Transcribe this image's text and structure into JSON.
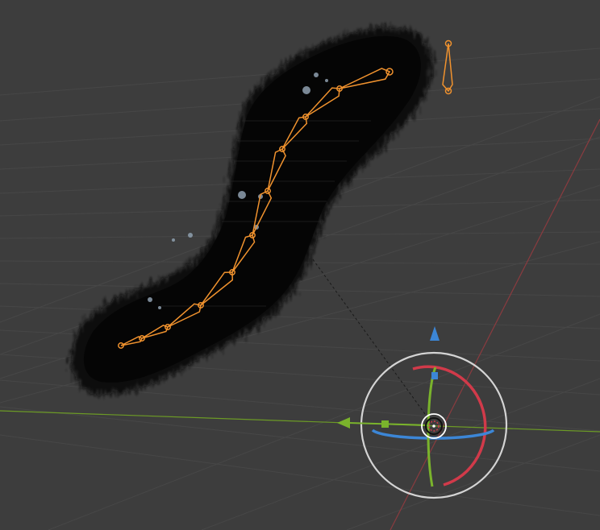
{
  "viewport": {
    "background": "#3d3d3d",
    "grid_color": "#474747",
    "x_axis_color": "#8a3b3f",
    "y_axis_color": "#6c9a26"
  },
  "object": {
    "fur_color": "#0a0a0a",
    "bone_color": "#f0922e"
  },
  "gizmo": {
    "outer_ring_color": "#d4d4d4",
    "x_color": "#d13a4a",
    "y_color": "#7ab32c",
    "z_color": "#3c86d6"
  },
  "icons": {
    "z_handle": "arrow-up-icon",
    "y_handle": "arrow-left-icon",
    "pivot": "crosshair-icon"
  }
}
